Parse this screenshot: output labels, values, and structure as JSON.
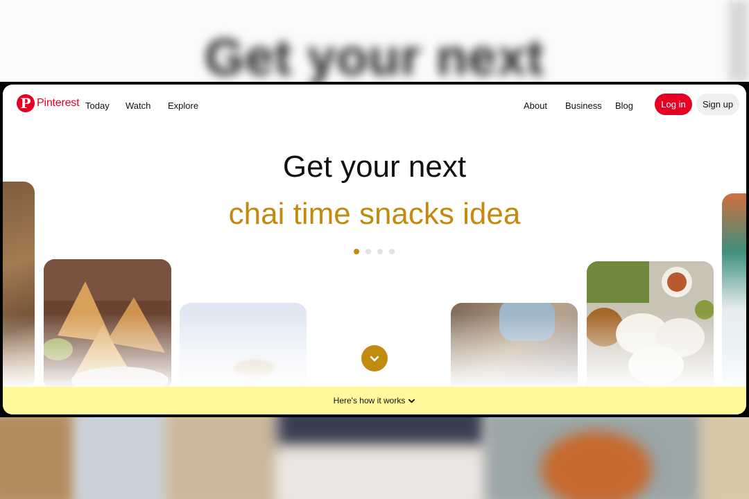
{
  "background": {
    "heading": "Get your next"
  },
  "nav": {
    "logo_text": "Pinterest",
    "links_left": [
      "Today",
      "Watch",
      "Explore"
    ],
    "links_right": [
      "About",
      "Business",
      "Blog"
    ],
    "login_label": "Log in",
    "signup_label": "Sign up"
  },
  "hero": {
    "title": "Get your next",
    "subtitle": "chai time snacks idea",
    "carousel": {
      "total": 4,
      "active_index": 0
    }
  },
  "footer_bar": {
    "label": "Here's how it works"
  },
  "colors": {
    "brand": "#e60023",
    "accent": "#c28b0f",
    "bar": "#fff99c"
  },
  "icons": [
    "pinterest-logo-icon",
    "chevron-down-icon"
  ]
}
